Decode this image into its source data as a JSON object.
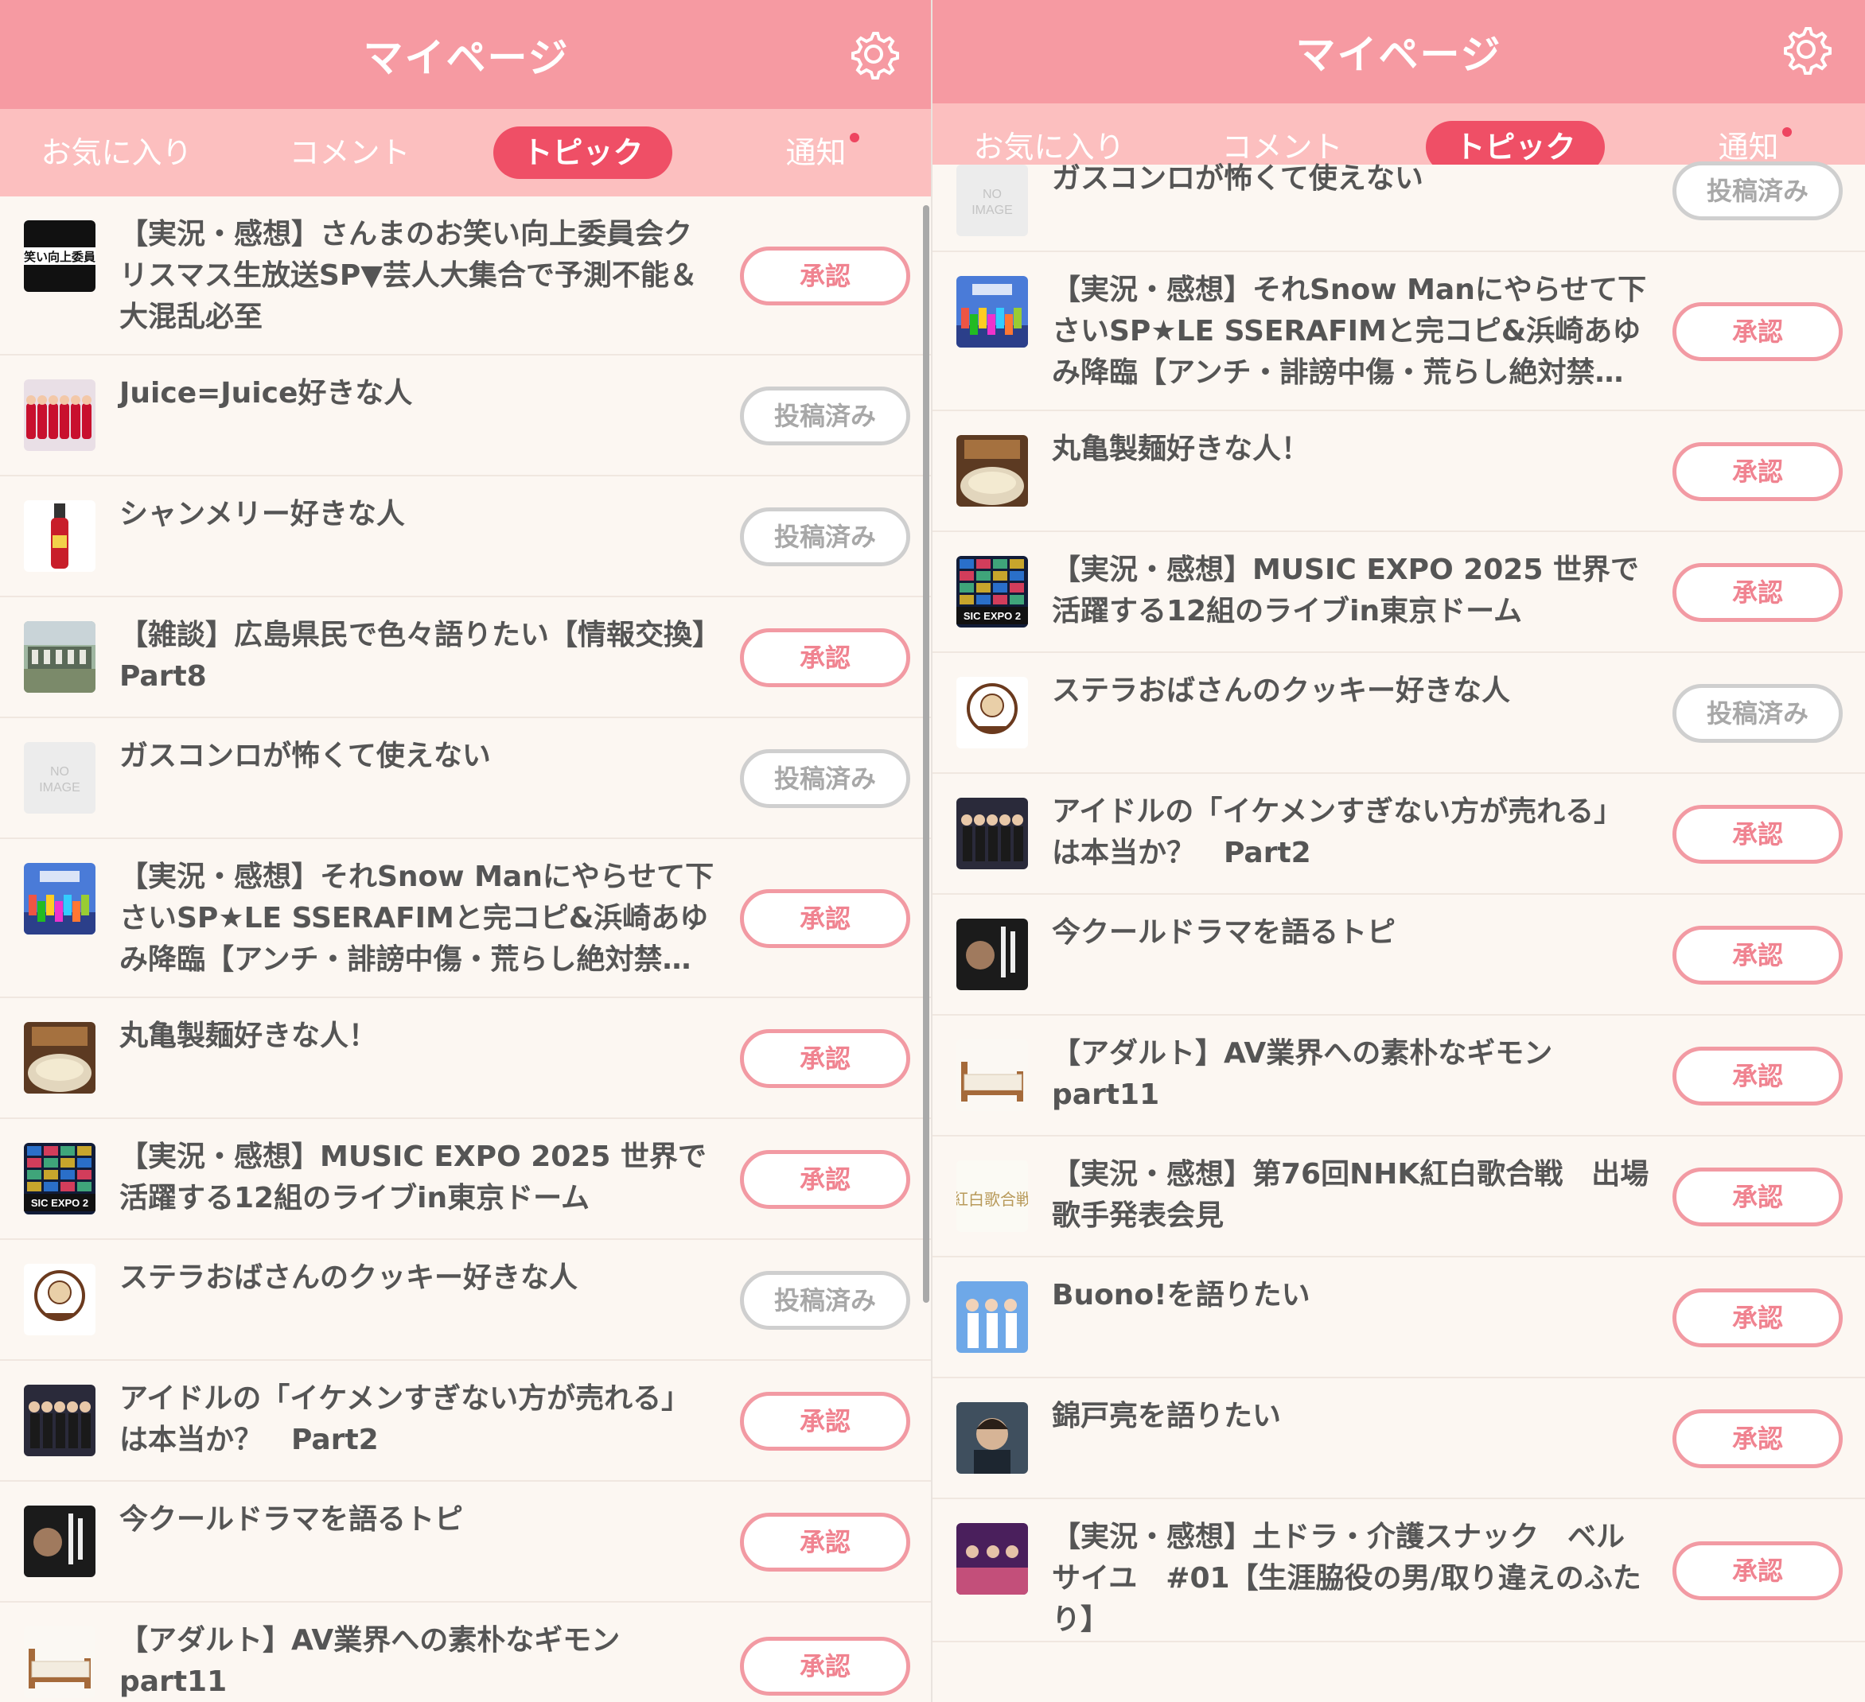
{
  "left": {
    "header": {
      "title": "マイページ"
    },
    "tabs": [
      {
        "label": "お気に入り",
        "active": false,
        "dot": false
      },
      {
        "label": "コメント",
        "active": false,
        "dot": false
      },
      {
        "label": "トピック",
        "active": true,
        "dot": false
      },
      {
        "label": "通知",
        "active": false,
        "dot": true
      }
    ],
    "items": [
      {
        "title": "【実況・感想】さんまのお笑い向上委員会クリスマス生放送SP▼芸人大集合で予測不能＆大混乱必至",
        "button": "承認",
        "status": "approve",
        "thumb": "thumb-owarai"
      },
      {
        "title": "Juice=Juice好きな人",
        "button": "投稿済み",
        "status": "posted",
        "thumb": "thumb-juice"
      },
      {
        "title": "シャンメリー好きな人",
        "button": "投稿済み",
        "status": "posted",
        "thumb": "thumb-bottle"
      },
      {
        "title": "【雑談】広島県民で色々語りたい【情報交換】Part8",
        "button": "承認",
        "status": "approve",
        "thumb": "thumb-city"
      },
      {
        "title": "ガスコンロが怖くて使えない",
        "button": "投稿済み",
        "status": "posted",
        "thumb": "thumb-noimage"
      },
      {
        "title": "【実況・感想】それSnow Manにやらせて下さいSP★LE SSERAFIMと完コピ&浜崎あゆみ降臨【アンチ・誹謗中傷・荒らし絶対禁…",
        "button": "承認",
        "status": "approve",
        "thumb": "thumb-snowman"
      },
      {
        "title": "丸亀製麺好きな人！",
        "button": "承認",
        "status": "approve",
        "thumb": "thumb-udon"
      },
      {
        "title": "【実況・感想】MUSIC EXPO 2025 世界で活躍する12組のライブin東京ドーム",
        "button": "承認",
        "status": "approve",
        "thumb": "thumb-expo"
      },
      {
        "title": "ステラおばさんのクッキー好きな人",
        "button": "投稿済み",
        "status": "posted",
        "thumb": "thumb-stella"
      },
      {
        "title": "アイドルの「イケメンすぎない方が売れる」は本当か？　Part2",
        "button": "承認",
        "status": "approve",
        "thumb": "thumb-idol"
      },
      {
        "title": "今クールドラマを語るトピ",
        "button": "承認",
        "status": "approve",
        "thumb": "thumb-drama"
      },
      {
        "title": "【アダルト】AV業界への素朴なギモン part11",
        "button": "承認",
        "status": "approve",
        "thumb": "thumb-bed"
      }
    ]
  },
  "right": {
    "header": {
      "title": "マイページ"
    },
    "tabs": [
      {
        "label": "お気に入り",
        "active": false,
        "dot": false
      },
      {
        "label": "コメント",
        "active": false,
        "dot": false
      },
      {
        "label": "トピック",
        "active": true,
        "dot": false
      },
      {
        "label": "通知",
        "active": false,
        "dot": true
      }
    ],
    "items": [
      {
        "title": "ガスコンロが怖くて使えない",
        "button": "投稿済み",
        "status": "posted",
        "thumb": "thumb-noimage"
      },
      {
        "title": "【実況・感想】それSnow Manにやらせて下さいSP★LE SSERAFIMと完コピ&浜崎あゆみ降臨【アンチ・誹謗中傷・荒らし絶対禁…",
        "button": "承認",
        "status": "approve",
        "thumb": "thumb-snowman"
      },
      {
        "title": "丸亀製麺好きな人！",
        "button": "承認",
        "status": "approve",
        "thumb": "thumb-udon"
      },
      {
        "title": "【実況・感想】MUSIC EXPO 2025 世界で活躍する12組のライブin東京ドーム",
        "button": "承認",
        "status": "approve",
        "thumb": "thumb-expo"
      },
      {
        "title": "ステラおばさんのクッキー好きな人",
        "button": "投稿済み",
        "status": "posted",
        "thumb": "thumb-stella"
      },
      {
        "title": "アイドルの「イケメンすぎない方が売れる」は本当か？　Part2",
        "button": "承認",
        "status": "approve",
        "thumb": "thumb-idol"
      },
      {
        "title": "今クールドラマを語るトピ",
        "button": "承認",
        "status": "approve",
        "thumb": "thumb-drama"
      },
      {
        "title": "【アダルト】AV業界への素朴なギモン part11",
        "button": "承認",
        "status": "approve",
        "thumb": "thumb-bed"
      },
      {
        "title": "【実況・感想】第76回NHK紅白歌合戦　出場歌手発表会見",
        "button": "承認",
        "status": "approve",
        "thumb": "thumb-kohaku"
      },
      {
        "title": "Buono!を語りたい",
        "button": "承認",
        "status": "approve",
        "thumb": "thumb-buono"
      },
      {
        "title": "錦戸亮を語りたい",
        "button": "承認",
        "status": "approve",
        "thumb": "thumb-nishikido"
      },
      {
        "title": "【実況・感想】土ドラ・介護スナック　ベルサイユ　#01【生涯脇役の男/取り違えのふたり】",
        "button": "承認",
        "status": "approve",
        "thumb": "thumb-snack"
      }
    ]
  },
  "thumb_texts": {
    "owarai": "笑い向上委員",
    "noimage_line1": "NO",
    "noimage_line2": "IMAGE",
    "expo": "SIC EXPO 2",
    "kohaku": "紅白歌合戦"
  },
  "colors": {
    "header": "#f69aa2",
    "tabs_bg": "#fcbfbf",
    "active_tab": "#ef4f66",
    "approve": "#f08390",
    "posted": "#a8a8a8"
  }
}
